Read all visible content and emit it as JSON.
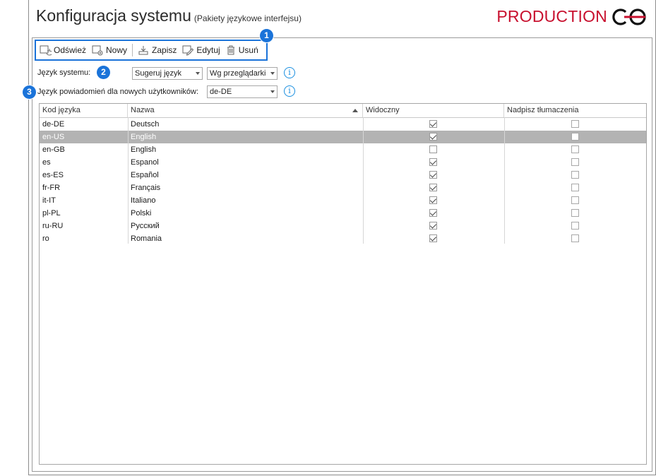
{
  "header": {
    "title": "Konfiguracja systemu",
    "subtitle": "(Pakiety językowe interfejsu)",
    "brand": "PRODUCTION"
  },
  "toolbar": {
    "refresh_label": "Odśwież",
    "new_label": "Nowy",
    "save_label": "Zapisz",
    "edit_label": "Edytuj",
    "delete_label": "Usuń"
  },
  "badges": {
    "one": "1",
    "two": "2",
    "three": "3"
  },
  "settings": {
    "system_language_label": "Język systemu:",
    "system_language_mode": "Sugeruj język",
    "system_language_value": "Wg przeglądarki",
    "notify_language_label": "Język powiadomień dla nowych użytkowników:",
    "notify_language_value": "de-DE"
  },
  "table": {
    "headers": {
      "code": "Kod języka",
      "name": "Nazwa",
      "visible": "Widoczny",
      "override": "Nadpisz tłumaczenia"
    },
    "rows": [
      {
        "code": "de-DE",
        "name": "Deutsch",
        "visible": true,
        "override": false,
        "selected": false
      },
      {
        "code": "en-US",
        "name": "English",
        "visible": true,
        "override": false,
        "selected": true
      },
      {
        "code": "en-GB",
        "name": "English",
        "visible": false,
        "override": false,
        "selected": false
      },
      {
        "code": "es",
        "name": "Espanol",
        "visible": true,
        "override": false,
        "selected": false
      },
      {
        "code": "es-ES",
        "name": "Español",
        "visible": true,
        "override": false,
        "selected": false
      },
      {
        "code": "fr-FR",
        "name": "Français",
        "visible": true,
        "override": false,
        "selected": false
      },
      {
        "code": "it-IT",
        "name": "Italiano",
        "visible": true,
        "override": false,
        "selected": false
      },
      {
        "code": "pl-PL",
        "name": "Polski",
        "visible": true,
        "override": false,
        "selected": false
      },
      {
        "code": "ru-RU",
        "name": "Русский",
        "visible": true,
        "override": false,
        "selected": false
      },
      {
        "code": "ro",
        "name": "Romania",
        "visible": true,
        "override": false,
        "selected": false
      }
    ]
  },
  "icons": {
    "refresh": "refresh-icon",
    "new": "new-document-icon",
    "save": "save-icon",
    "edit": "edit-icon",
    "delete": "trash-icon",
    "info": "info-icon",
    "logo": "production-logo-icon"
  },
  "colors": {
    "accent": "#1a73d9",
    "brand": "#c8102e",
    "selected_row": "#b3b3b3",
    "info": "#1a8fe0"
  }
}
